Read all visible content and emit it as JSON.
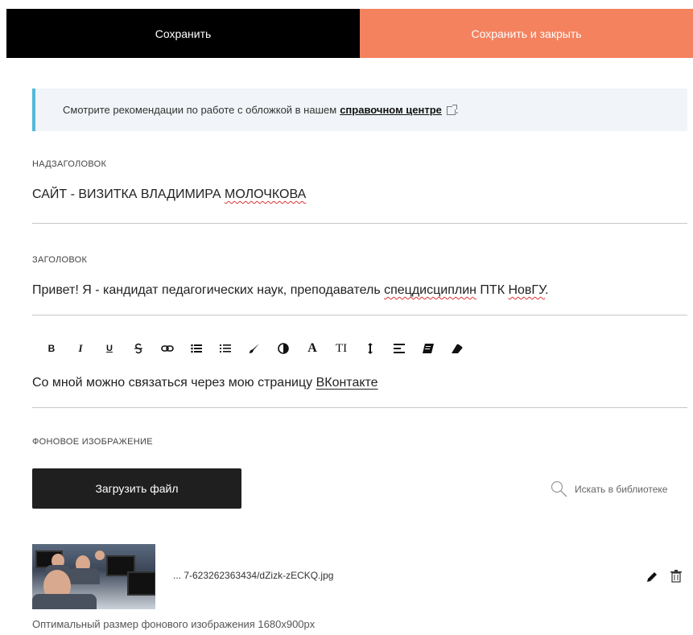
{
  "topbar": {
    "save_label": "Сохранить",
    "save_close_label": "Сохранить и закрыть"
  },
  "info": {
    "text": "Смотрите рекомендации по работе с обложкой в нашем",
    "link": "справочном центре",
    "tail": "."
  },
  "supertitle": {
    "label": "НАДЗАГОЛОВОК",
    "value_prefix": "САЙТ - ВИЗИТКА ВЛАДИМИРА ",
    "value_misspelled": "МОЛОЧКОВА"
  },
  "title": {
    "label": "ЗАГОЛОВОК",
    "part1": "Привет! Я - кандидат педагогических наук, преподаватель ",
    "misspelled1": "спецдисциплин",
    "part2": " ПТК ",
    "misspelled2": "НовГУ",
    "part3": "."
  },
  "editor": {
    "tools": [
      "bold-icon",
      "italic-icon",
      "underline-icon",
      "strikethrough-icon",
      "link-icon",
      "bulleted-list-icon",
      "numbered-list-icon",
      "brush-icon",
      "contrast-icon",
      "font-icon",
      "text-size-icon",
      "line-height-icon",
      "align-icon",
      "block-icon",
      "eraser-icon"
    ],
    "glyphs": {
      "bold": "B",
      "italic": "I",
      "underline": "U",
      "font": "A",
      "text_size": "TI"
    },
    "text_prefix": "Со мной можно связаться через мою страницу ",
    "text_link": "ВКонтакте"
  },
  "background": {
    "label": "ФОНОВОЕ ИЗОБРАЖЕНИЕ",
    "upload_label": "Загрузить файл",
    "search_label": "Искать в библиотеке",
    "filename": "... 7-623262363434/dZizk-zECKQ.jpg",
    "hint": "Оптимальный размер фонового изображения 1680x900px"
  },
  "colors": {
    "accent": "#f4825f",
    "info_border": "#54b8d9",
    "dark_button": "#1f1f1f"
  }
}
